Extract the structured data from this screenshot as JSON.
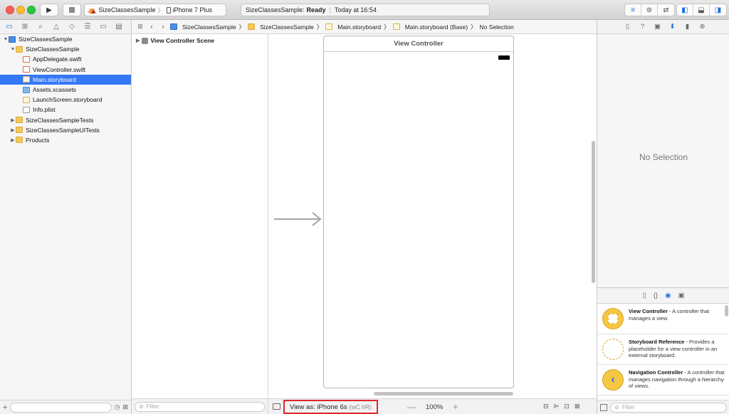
{
  "toolbar": {
    "scheme_target": "SizeClassesSample",
    "scheme_device": "iPhone 7 Plus",
    "status_project": "SizeClassesSample:",
    "status_state": "Ready",
    "status_time": "Today at 16:54"
  },
  "navigator": {
    "items": [
      {
        "label": "SizeClassesSample",
        "icon": "project-icon",
        "level": 0,
        "disclosure": "▼"
      },
      {
        "label": "SizeClassesSample",
        "icon": "folder-icon",
        "level": 1,
        "disclosure": "▼"
      },
      {
        "label": "AppDelegate.swift",
        "icon": "swift-file-icon",
        "level": 2,
        "disclosure": ""
      },
      {
        "label": "ViewController.swift",
        "icon": "swift-file-icon",
        "level": 2,
        "disclosure": ""
      },
      {
        "label": "Main.storyboard",
        "icon": "storyboard-icon",
        "level": 2,
        "disclosure": "",
        "selected": true
      },
      {
        "label": "Assets.xcassets",
        "icon": "assets-icon",
        "level": 2,
        "disclosure": ""
      },
      {
        "label": "LaunchScreen.storyboard",
        "icon": "storyboard-icon",
        "level": 2,
        "disclosure": ""
      },
      {
        "label": "Info.plist",
        "icon": "plist-icon",
        "level": 2,
        "disclosure": ""
      },
      {
        "label": "SizeClassesSampleTests",
        "icon": "folder-icon",
        "level": 0,
        "disclosure": "▶"
      },
      {
        "label": "SizeClassesSampleUITests",
        "icon": "folder-icon",
        "level": 0,
        "disclosure": "▶"
      },
      {
        "label": "Products",
        "icon": "folder-icon",
        "level": 0,
        "disclosure": "▶"
      }
    ]
  },
  "jumpbar": {
    "crumbs": [
      "SizeClassesSample",
      "SizeClassesSample",
      "Main.storyboard",
      "Main.storyboard (Base)",
      "No Selection"
    ]
  },
  "outline": {
    "scene": "View Controller Scene",
    "filter_placeholder": "Filter"
  },
  "canvas": {
    "vc_title": "View Controller",
    "view_as_label": "View as: iPhone 6s",
    "view_as_traits": "(wC hR)",
    "zoom": "100%"
  },
  "utilities": {
    "no_selection": "No Selection",
    "library": [
      {
        "name": "View Controller",
        "desc": " - A controller that manages a view."
      },
      {
        "name": "Storyboard Reference",
        "desc": " - Provides a placeholder for a view controller in an external storyboard."
      },
      {
        "name": "Navigation Controller",
        "desc": " - A controller that manages navigation through a hierarchy of views."
      }
    ],
    "filter_placeholder": "Filter"
  },
  "colors": {
    "selection": "#3478f6",
    "accent": "#1a6fe2",
    "highlight_border": "#e0262b",
    "library_icon": "#f6c742"
  }
}
